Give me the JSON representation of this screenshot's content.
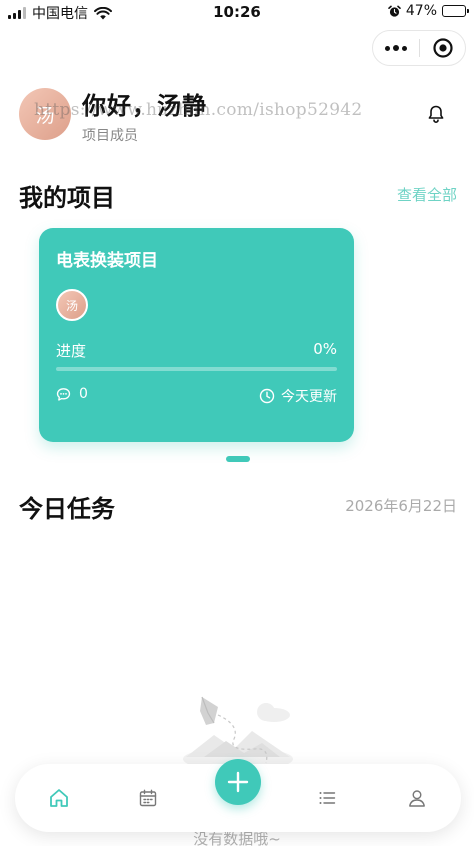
{
  "status_bar": {
    "carrier": "中国电信",
    "time": "10:26",
    "battery": "47%",
    "battery_level": 0.47
  },
  "header": {
    "avatar_char": "汤",
    "greeting": "你好，汤静",
    "role": "项目成员",
    "watermark": "https://www.huzhan.com/ishop52942"
  },
  "projects": {
    "title": "我的项目",
    "view_all": "查看全部",
    "cards": [
      {
        "name": "电表换装项目",
        "member_char": "汤",
        "progress_label": "进度",
        "progress_text": "0%",
        "progress": 0,
        "comments": "0",
        "updated": "今天更新"
      }
    ]
  },
  "today": {
    "title": "今日任务",
    "date": "2026年6月22日",
    "empty_text": "没有数据哦~"
  },
  "tabbar": {
    "items": [
      "home-icon",
      "calendar-icon",
      "add-icon",
      "list-icon",
      "user-icon"
    ]
  },
  "colors": {
    "accent": "#40c9b9",
    "accent_light": "#6fd3c5"
  }
}
